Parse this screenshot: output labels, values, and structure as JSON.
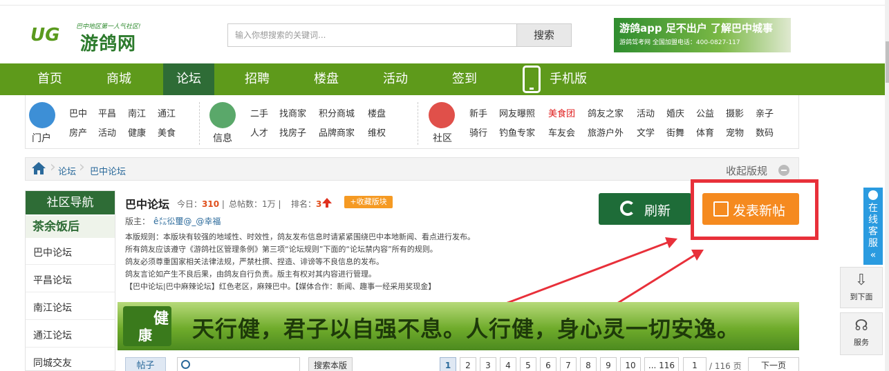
{
  "header": {
    "logo_slogan": "巴中地区第一人气社区!",
    "logo_mark": "UG",
    "logo_name": "游鸽网",
    "search_placeholder": "输入你想搜索的关键词...",
    "search_button": "搜索",
    "ad_line1": "游鸽app 足不出户 了解巴中城事",
    "ad_line2": "游鸽驾考网 全国加盟电话：400-0827-117"
  },
  "nav": {
    "items": [
      "首页",
      "商城",
      "论坛",
      "招聘",
      "楼盘",
      "活动",
      "签到",
      "手机版"
    ],
    "active_index": 2,
    "colors": {
      "bar": "#5e9a1b",
      "active": "#2e6c36"
    }
  },
  "categories": {
    "portal": {
      "label": "门户",
      "links": [
        "巴中",
        "平昌",
        "南江",
        "通江",
        "房产",
        "活动",
        "健康",
        "美食"
      ]
    },
    "info": {
      "label": "信息",
      "links": [
        "二手",
        "找商家",
        "积分商城",
        "楼盘",
        "人才",
        "找房子",
        "品牌商家",
        "维权"
      ]
    },
    "community": {
      "label": "社区",
      "links": [
        "新手",
        "网友曝照",
        "美食团",
        "鸽友之家",
        "活动",
        "婚庆",
        "公益",
        "摄影",
        "亲子",
        "骑行",
        "钓鱼专家",
        "车友会",
        "旅游户外",
        "文学",
        "街舞",
        "体育",
        "宠物",
        "数码"
      ],
      "highlight": "美食团"
    }
  },
  "breadcrumb": {
    "items": [
      "论坛",
      "巴中论坛"
    ],
    "fold_label": "收起版规"
  },
  "sidebar": {
    "title": "社区导航",
    "subtitle": "茶余饭后",
    "items": [
      "巴中论坛",
      "平昌论坛",
      "南江论坛",
      "通江论坛",
      "同城交友"
    ]
  },
  "board": {
    "title": "巴中论坛",
    "today_label": "今日：",
    "today_value": "310",
    "total_label": "总帖数：",
    "total_value": "1万",
    "rank_label": "排名：",
    "rank_value": "3",
    "fav_button": "+收藏版块",
    "moderator_label": "版主：",
    "moderator_name": "ê㍍彸璽@_@幸福",
    "rules": [
      "本版规则：本版块有较强的地域性、时效性，鸽友发布信息时请紧紧围绕巴中本地新闻、看点进行发布。",
      "所有鸽友应该遵守《游鸽社区管理条例》第三项“论坛规则”下面的“论坛禁内容”所有的规则。",
      "鸽友必须尊重国家相关法律法规，严禁杜撰、捏造、诽谤等不良信息的发布。",
      "鸽友言论如产生不良后果，由鸽友自行负责。版主有权对其内容进行管理。",
      "【巴中论坛|巴中麻辣论坛】红色老区，麻辣巴中。【媒体合作：新闻、趣事一经采用奖现金】"
    ],
    "refresh_button": "刷新",
    "post_button": "发表新帖"
  },
  "health_banner": {
    "badge_top": "健",
    "badge_bottom": "康",
    "slogan": "天行健，君子以自强不息。人行健，身心灵一切安逸。"
  },
  "toolbar": {
    "tab_label": "帖子",
    "search_button": "搜索本版",
    "pages": [
      "1",
      "2",
      "3",
      "4",
      "5",
      "6",
      "7",
      "8",
      "9",
      "10",
      "... 116"
    ],
    "current_page": "1",
    "page_input": "1",
    "page_total": "/ 116 页",
    "next_label": "下一页"
  },
  "floats": {
    "service_label": "在线客服",
    "service_collapse": "«",
    "down_label": "到下面",
    "service2_label": "服务"
  },
  "accent_colors": {
    "highlight": "#e8303a",
    "post_button": "#f58a1f",
    "refresh_button": "#1e6c38"
  }
}
